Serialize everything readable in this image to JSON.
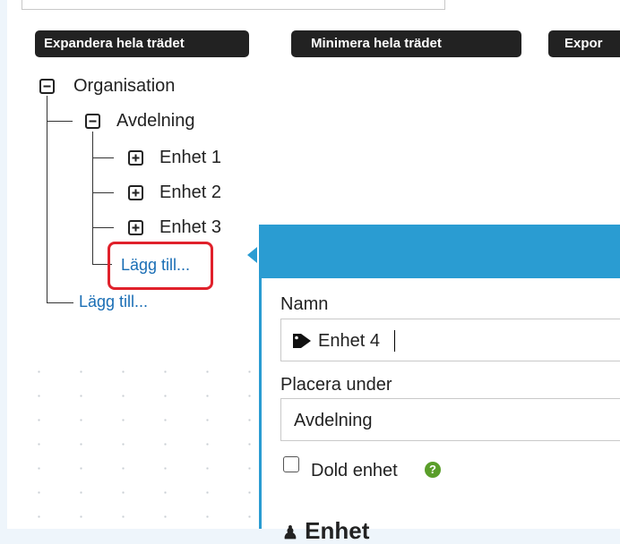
{
  "toolbar": {
    "expand_label": "Expandera hela trädet",
    "collapse_label": "Minimera hela trädet",
    "export_label": "Expor"
  },
  "tree": {
    "root": {
      "label": "Organisation",
      "toggle": "minus-box-icon"
    },
    "department": {
      "label": "Avdelning",
      "toggle": "minus-box-icon"
    },
    "units": [
      {
        "label": "Enhet 1",
        "toggle": "plus-box-icon"
      },
      {
        "label": "Enhet 2",
        "toggle": "plus-box-icon"
      },
      {
        "label": "Enhet 3",
        "toggle": "plus-box-icon"
      }
    ],
    "add_under_department": "Lägg till...",
    "add_under_root": "Lägg till..."
  },
  "popup": {
    "header_color": "#2a9cd2",
    "name_label": "Namn",
    "name_value": "Enhet 4",
    "name_icon": "tag-icon",
    "parent_label": "Placera under",
    "parent_value": "Avdelning",
    "hidden_label": "Dold enhet",
    "hidden_checked": false,
    "help_icon": "question-icon",
    "section_partial": "Enhet"
  },
  "colors": {
    "highlight": "#e0212b",
    "link": "#1a6eb5",
    "help": "#5a9e2a"
  }
}
